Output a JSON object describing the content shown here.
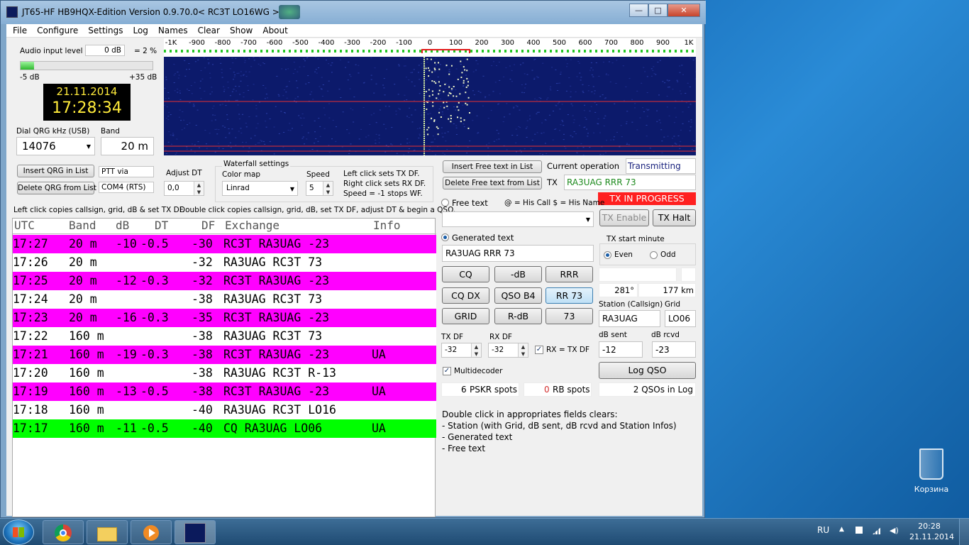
{
  "window": {
    "title": "JT65-HF HB9HQX-Edition Version 0.9.70.0",
    "title_extra": "< RC3T LO16WG >",
    "controls": {
      "minimize": "—",
      "maximize": "□",
      "close": "✕"
    }
  },
  "menu": [
    "File",
    "Configure",
    "Settings",
    "Log",
    "Names",
    "Clear",
    "Show",
    "About"
  ],
  "audio": {
    "label": "Audio input level =",
    "db": "0 dB",
    "percent": "= 2 %",
    "min": "-5 dB",
    "max": "+35 dB",
    "level_fraction": 0.1
  },
  "clock": {
    "date": "21.11.2014",
    "time": "17:28:34"
  },
  "dial": {
    "label": "Dial QRG kHz (USB)",
    "value": "14076",
    "band_label": "Band",
    "band_value": "20 m"
  },
  "qrg_buttons": {
    "insert": "Insert QRG in List",
    "delete": "Delete QRG from List"
  },
  "ptt": {
    "label": "PTT via",
    "value": "COM4 (RTS)"
  },
  "adjust_dt": {
    "label": "Adjust DT",
    "value": "0,0"
  },
  "waterfall_settings": {
    "legend": "Waterfall settings",
    "color_map_label": "Color map",
    "color_map": "Linrad",
    "speed_label": "Speed",
    "speed": "5",
    "help": [
      "Left click sets TX DF.",
      "Right click sets RX DF.",
      "Speed = -1 stops WF."
    ]
  },
  "scale_ticks": [
    "-1K",
    "-900",
    "-800",
    "-700",
    "-600",
    "-500",
    "-400",
    "-300",
    "-200",
    "-100",
    "0",
    "100",
    "200",
    "300",
    "400",
    "500",
    "600",
    "700",
    "800",
    "900",
    "1K"
  ],
  "hints": {
    "left": "Left click copies callsign, grid, dB & set TX DF.",
    "right": "Double click copies callsign, grid, dB, set TX DF, adjust DT & begin a QSO."
  },
  "rx_table": {
    "headers": [
      "UTC",
      "Band",
      "dB",
      "DT",
      "DF",
      "Exchange",
      "Info"
    ],
    "rows": [
      {
        "utc": "17:27",
        "band": "20 m",
        "db": "-10",
        "dt": "-0.5",
        "df": "-30",
        "ex": "RC3T RA3UAG -23",
        "info": "",
        "color": "#ff00ff"
      },
      {
        "utc": "17:26",
        "band": "20 m",
        "db": "",
        "dt": "",
        "df": "-32",
        "ex": "RA3UAG RC3T 73",
        "info": "",
        "color": "#ffffff"
      },
      {
        "utc": "17:25",
        "band": "20 m",
        "db": "-12",
        "dt": "-0.3",
        "df": "-32",
        "ex": "RC3T RA3UAG -23",
        "info": "",
        "color": "#ff00ff"
      },
      {
        "utc": "17:24",
        "band": "20 m",
        "db": "",
        "dt": "",
        "df": "-38",
        "ex": "RA3UAG RC3T 73",
        "info": "",
        "color": "#ffffff"
      },
      {
        "utc": "17:23",
        "band": "20 m",
        "db": "-16",
        "dt": "-0.3",
        "df": "-35",
        "ex": "RC3T RA3UAG -23",
        "info": "",
        "color": "#ff00ff"
      },
      {
        "utc": "17:22",
        "band": "160 m",
        "db": "",
        "dt": "",
        "df": "-38",
        "ex": "RA3UAG RC3T 73",
        "info": "",
        "color": "#ffffff"
      },
      {
        "utc": "17:21",
        "band": "160 m",
        "db": "-19",
        "dt": "-0.3",
        "df": "-38",
        "ex": "RC3T RA3UAG -23",
        "info": "UA",
        "color": "#ff00ff"
      },
      {
        "utc": "17:20",
        "band": "160 m",
        "db": "",
        "dt": "",
        "df": "-38",
        "ex": "RA3UAG RC3T R-13",
        "info": "",
        "color": "#ffffff"
      },
      {
        "utc": "17:19",
        "band": "160 m",
        "db": "-13",
        "dt": "-0.5",
        "df": "-38",
        "ex": "RC3T RA3UAG -23",
        "info": "UA",
        "color": "#ff00ff"
      },
      {
        "utc": "17:18",
        "band": "160 m",
        "db": "",
        "dt": "",
        "df": "-40",
        "ex": "RA3UAG RC3T LO16",
        "info": "",
        "color": "#ffffff"
      },
      {
        "utc": "17:17",
        "band": "160 m",
        "db": "-11",
        "dt": "-0.5",
        "df": "-40",
        "ex": "CQ RA3UAG LO06",
        "info": "UA",
        "color": "#00ff00"
      }
    ]
  },
  "free_text_buttons": {
    "insert": "Insert Free text in List",
    "delete": "Delete Free text from List"
  },
  "current_op": {
    "label": "Current operation",
    "value": "Transmitting"
  },
  "tx": {
    "label": "TX",
    "message": "RA3UAG RRR 73",
    "progress": "TX IN PROGRESS",
    "enable": "TX Enable",
    "halt": "TX Halt"
  },
  "free_text": {
    "label": "Free text",
    "legend": "@ = His Call  $ = His Name"
  },
  "generated": {
    "label": "Generated text",
    "value": "RA3UAG RRR 73"
  },
  "msg_buttons": [
    "CQ",
    "-dB",
    "RRR",
    "CQ DX",
    "QSO B4",
    "RR 73",
    "GRID",
    "R-dB",
    "73"
  ],
  "tx_start": {
    "legend": "TX start minute",
    "even": "Even",
    "odd": "Odd"
  },
  "bearing": {
    "azimuth": "281°",
    "distance": "177 km"
  },
  "station": {
    "callsign_label": "Station (Callsign)",
    "callsign": "RA3UAG",
    "grid_label": "Grid",
    "grid": "LO06"
  },
  "df": {
    "tx_label": "TX DF",
    "tx": "-32",
    "rx_label": "RX DF",
    "rx": "-32",
    "rx_eq_tx": "RX = TX DF"
  },
  "db_fields": {
    "sent_label": "dB sent",
    "sent": "-12",
    "rcvd_label": "dB rcvd",
    "rcvd": "-23"
  },
  "multidecoder": "Multidecoder",
  "log_qso": "Log QSO",
  "spots": {
    "pskr_count": "6",
    "pskr_label": "PSKR spots",
    "rb_count": "0",
    "rb_label": "RB spots",
    "qsos": "2 QSOs in Log"
  },
  "help_text": [
    "Double click in appropriates fields clears:",
    "- Station (with Grid, dB sent, dB rcvd and Station Infos)",
    "- Generated text",
    "- Free text"
  ],
  "desktop": {
    "recycle_bin": "Корзина"
  },
  "tray": {
    "lang": "RU",
    "time": "20:28",
    "date": "21.11.2014"
  },
  "colors": {
    "waterfall": "#0c1a6b",
    "tx_progress": "#ff2020",
    "cq_row": "#00ff00",
    "reply_row": "#ff00ff"
  }
}
